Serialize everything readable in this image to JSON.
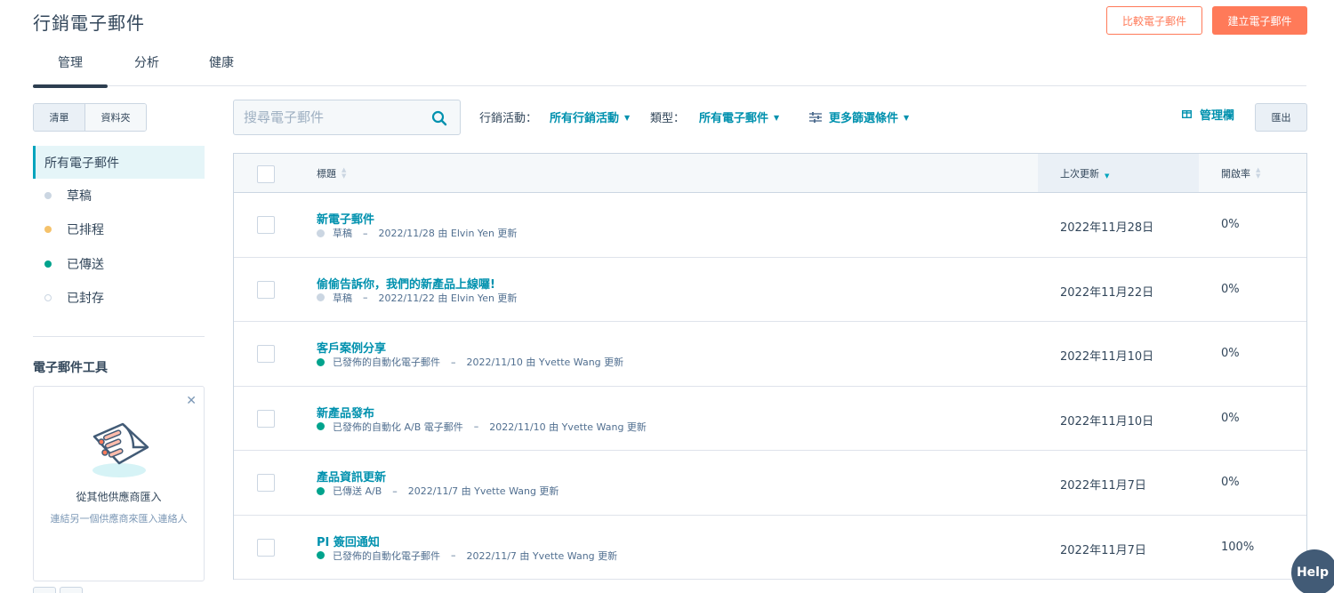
{
  "header": {
    "title": "行銷電子郵件",
    "compare_button": "比較電子郵件",
    "create_button": "建立電子郵件"
  },
  "tabs": [
    {
      "label": "管理",
      "active": true
    },
    {
      "label": "分析",
      "active": false
    },
    {
      "label": "健康",
      "active": false
    }
  ],
  "sidebar": {
    "view_toggle": [
      "清單",
      "資料夾"
    ],
    "filters": [
      {
        "label": "所有電子郵件",
        "active": true,
        "color": ""
      },
      {
        "label": "草稿",
        "color": "#cbd6e2"
      },
      {
        "label": "已排程",
        "color": "#f5c26b"
      },
      {
        "label": "已傳送",
        "color": "#00bda5"
      },
      {
        "label": "已封存",
        "color": "#ffffff"
      }
    ],
    "tools_title": "電子郵件工具",
    "import_card": {
      "title": "從其他供應商匯入",
      "subtitle": "連結另一個供應商來匯入連絡人"
    }
  },
  "toolbar": {
    "search_placeholder": "搜尋電子郵件",
    "campaign_label": "行銷活動：",
    "campaign_value": "所有行銷活動",
    "type_label": "類型：",
    "type_value": "所有電子郵件",
    "more_filters": "更多篩選條件",
    "manage_columns": "管理欄",
    "export_button": "匯出"
  },
  "table": {
    "columns": [
      "標題",
      "上次更新",
      "開啟率"
    ],
    "rows": [
      {
        "title": "新電子郵件",
        "status": "草稿",
        "status_color": "#cbd6e2",
        "updated_text": "2022/11/28 由 Elvin Yen 更新",
        "last_updated": "2022年11月28日",
        "open_rate": "0%"
      },
      {
        "title": "偷偷告訴你，我們的新產品上線囉!",
        "status": "草稿",
        "status_color": "#cbd6e2",
        "updated_text": "2022/11/22 由 Elvin Yen 更新",
        "last_updated": "2022年11月22日",
        "open_rate": "0%"
      },
      {
        "title": "客戶案例分享",
        "status": "已發佈的自動化電子郵件",
        "status_color": "#00a38d",
        "updated_text": "2022/11/10 由 Yvette Wang 更新",
        "last_updated": "2022年11月10日",
        "open_rate": "0%"
      },
      {
        "title": "新產品發布",
        "status": "已發佈的自動化 A/B 電子郵件",
        "status_color": "#00a38d",
        "updated_text": "2022/11/10 由 Yvette Wang 更新",
        "last_updated": "2022年11月10日",
        "open_rate": "0%"
      },
      {
        "title": "產品資訊更新",
        "status": "已傳送 A/B",
        "status_color": "#00a38d",
        "updated_text": "2022/11/7 由 Yvette Wang 更新",
        "last_updated": "2022年11月7日",
        "open_rate": "0%"
      },
      {
        "title": "PI 簽回通知",
        "status": "已發佈的自動化電子郵件",
        "status_color": "#00a38d",
        "updated_text": "2022/11/7 由 Yvette Wang 更新",
        "last_updated": "2022年11月7日",
        "open_rate": "100%"
      }
    ]
  },
  "help_button": "Help",
  "colors": {
    "accent": "#ff7a59",
    "link": "#0091ae",
    "text": "#33475b"
  }
}
